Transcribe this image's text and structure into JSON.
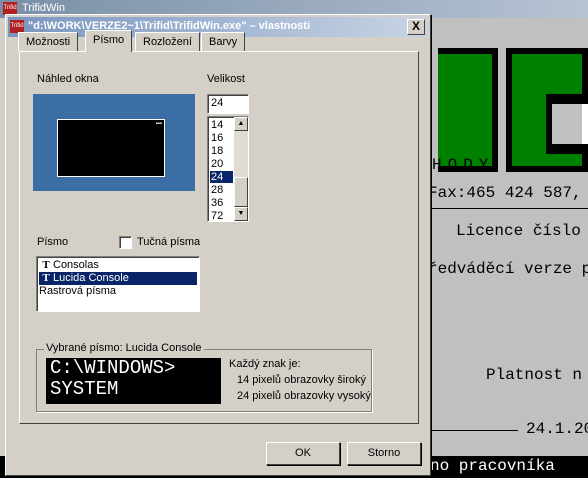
{
  "background_app": {
    "title": "TrifidWin",
    "icon": "app-icon",
    "console_lines": [
      "HODY",
      "Fax:465 424 587,",
      "Licence číslo",
      "ředváděcí verze p",
      "Platnost n",
      "24.1.20"
    ],
    "bottom_text": "no pracovníka",
    "colors": {
      "logo_green": "#008000",
      "console_bg": "#c0c0c0"
    }
  },
  "dialog": {
    "title": "\"d:\\WORK\\VERZE2~1\\Trifid\\TrifidWin.exe\" – vlastnosti",
    "close_label": "X",
    "tabs": [
      "Možnosti",
      "Písmo",
      "Rozložení",
      "Barvy"
    ],
    "active_tab": "Písmo",
    "preview_label": "Náhled okna",
    "size": {
      "label": "Velikost",
      "value": "24",
      "options": [
        "14",
        "16",
        "18",
        "20",
        "24",
        "28",
        "36",
        "72"
      ],
      "selected": "24"
    },
    "font": {
      "label": "Písmo",
      "bold_label": "Tučná písma",
      "bold_checked": false,
      "options": [
        {
          "icon": "truetype-icon",
          "name": "Consolas"
        },
        {
          "icon": "truetype-icon",
          "name": "Lucida Console"
        },
        {
          "icon": "",
          "name": "Rastrová písma"
        }
      ],
      "selected": "Lucida Console"
    },
    "selected_font": {
      "label": "Vybrané písmo: Lucida Console",
      "sample_line1": "C:\\WINDOWS>",
      "sample_line2": "SYSTEM",
      "char_label": "Každý znak je:",
      "width_text": "14 pixelů obrazovky široký",
      "height_text": "24 pixelů obrazovky vysoký"
    },
    "buttons": {
      "ok": "OK",
      "cancel": "Storno"
    },
    "colors": {
      "selection": "#0a246a",
      "preview_desktop": "#3a6ea5",
      "face": "#d4d0c8"
    }
  }
}
